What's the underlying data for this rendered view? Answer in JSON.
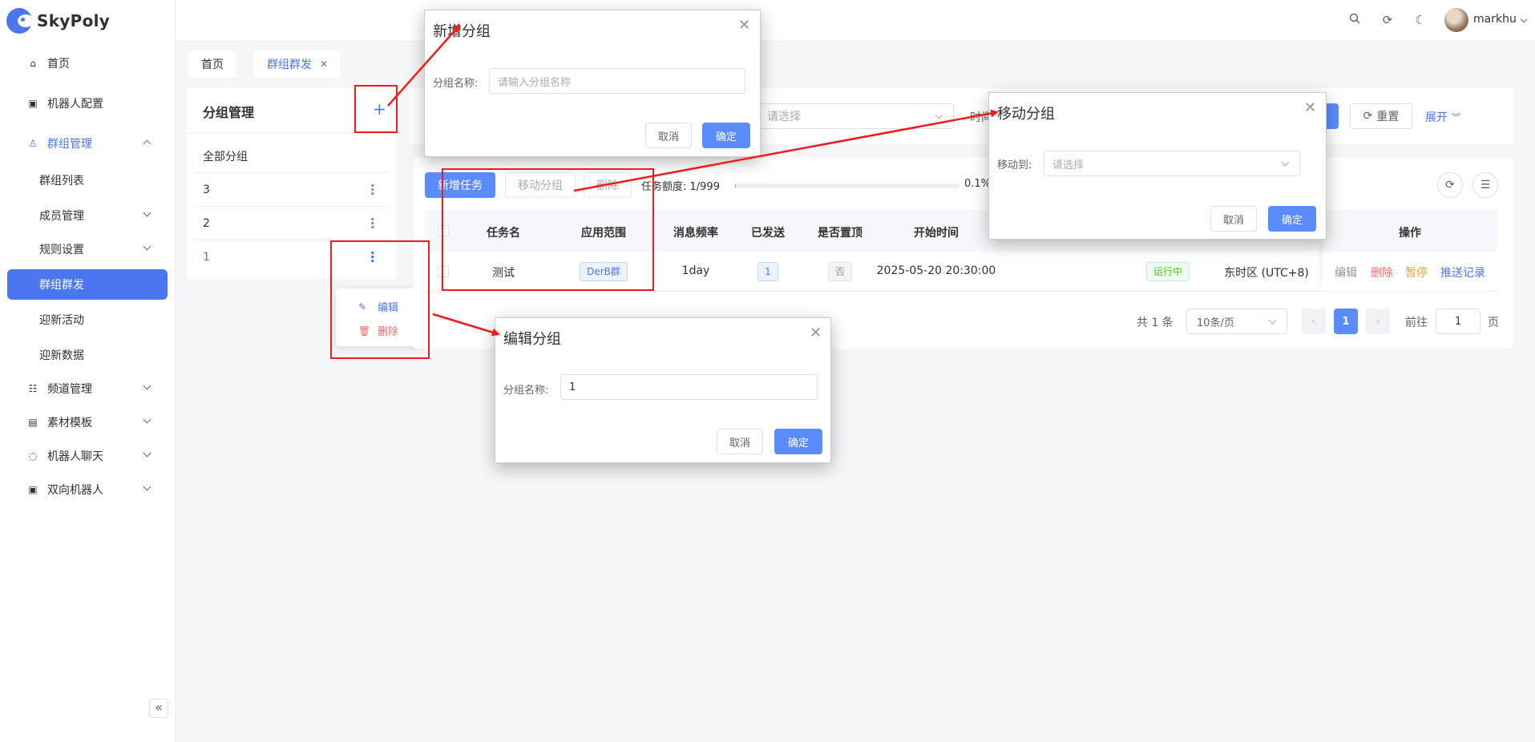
{
  "app": {
    "name": "SkyPoly"
  },
  "sidebar": {
    "items": [
      {
        "label": "首页",
        "icon": "home-icon"
      },
      {
        "label": "机器人配置",
        "icon": "robot-icon"
      },
      {
        "label": "群组管理",
        "icon": "users-icon"
      },
      {
        "label": "群组列表"
      },
      {
        "label": "成员管理"
      },
      {
        "label": "规则设置"
      },
      {
        "label": "群组群发"
      },
      {
        "label": "迎新活动"
      },
      {
        "label": "迎新数据"
      },
      {
        "label": "频道管理",
        "icon": "list-icon"
      },
      {
        "label": "素材模板",
        "icon": "ad-icon"
      },
      {
        "label": "机器人聊天",
        "icon": "chat-icon"
      },
      {
        "label": "双向机器人",
        "icon": "robot-icon"
      }
    ],
    "collapse_glyph": "«"
  },
  "header": {
    "username": "markhu"
  },
  "tabs": [
    {
      "label": "首页"
    },
    {
      "label": "群组群发"
    }
  ],
  "group_panel": {
    "title": "分组管理",
    "add_glyph": "+",
    "rows": [
      {
        "label": "全部分组"
      },
      {
        "label": "3"
      },
      {
        "label": "2"
      },
      {
        "label": "1"
      }
    ],
    "context_menu": {
      "edit": "编辑",
      "delete": "删除"
    }
  },
  "search": {
    "select_placeholder": "请选择",
    "time_label_partial": "时间",
    "reset_label": "重置",
    "expand_label": "展开"
  },
  "toolbar": {
    "add_task": "新增任务",
    "move_group": "移动分组",
    "delete": "删除",
    "quota_label": "任务额度: 1/999",
    "quota_fraction": 0.001,
    "quota_pct": "0.1%"
  },
  "table": {
    "headers": {
      "name": "任务名",
      "scope": "应用范围",
      "freq": "消息频率",
      "sent": "已发送",
      "pinned": "是否置顶",
      "start": "开始时间",
      "ops": "操作"
    },
    "row": {
      "name": "测试",
      "scope": "DerB群",
      "freq": "1day",
      "sent": "1",
      "pinned": "否",
      "start": "2025-05-20 20:30:00",
      "status": "运行中",
      "timezone": "东时区 (UTC+8)",
      "ops": {
        "edit": "编辑",
        "delete": "删除",
        "pause": "暂停",
        "log": "推送记录"
      }
    }
  },
  "pagination": {
    "total": "共 1 条",
    "page_size": "10条/页",
    "current": "1",
    "goto_label": "前往",
    "goto_value": "1",
    "page_suffix": "页"
  },
  "dialogs": {
    "add_group": {
      "title": "新增分组",
      "label": "分组名称:",
      "placeholder": "请输入分组名称",
      "cancel": "取消",
      "ok": "确定"
    },
    "move_group": {
      "title": "移动分组",
      "label": "移动到:",
      "placeholder": "请选择",
      "cancel": "取消",
      "ok": "确定"
    },
    "edit_group": {
      "title": "编辑分组",
      "label": "分组名称:",
      "value": "1",
      "cancel": "取消",
      "ok": "确定"
    }
  },
  "colors": {
    "primary": "#4a77f0",
    "button_primary": "#5b8cff",
    "danger": "#f56c6c",
    "warning": "#e6a23c",
    "success": "#52c41a",
    "annotation": "#f01b1b"
  }
}
